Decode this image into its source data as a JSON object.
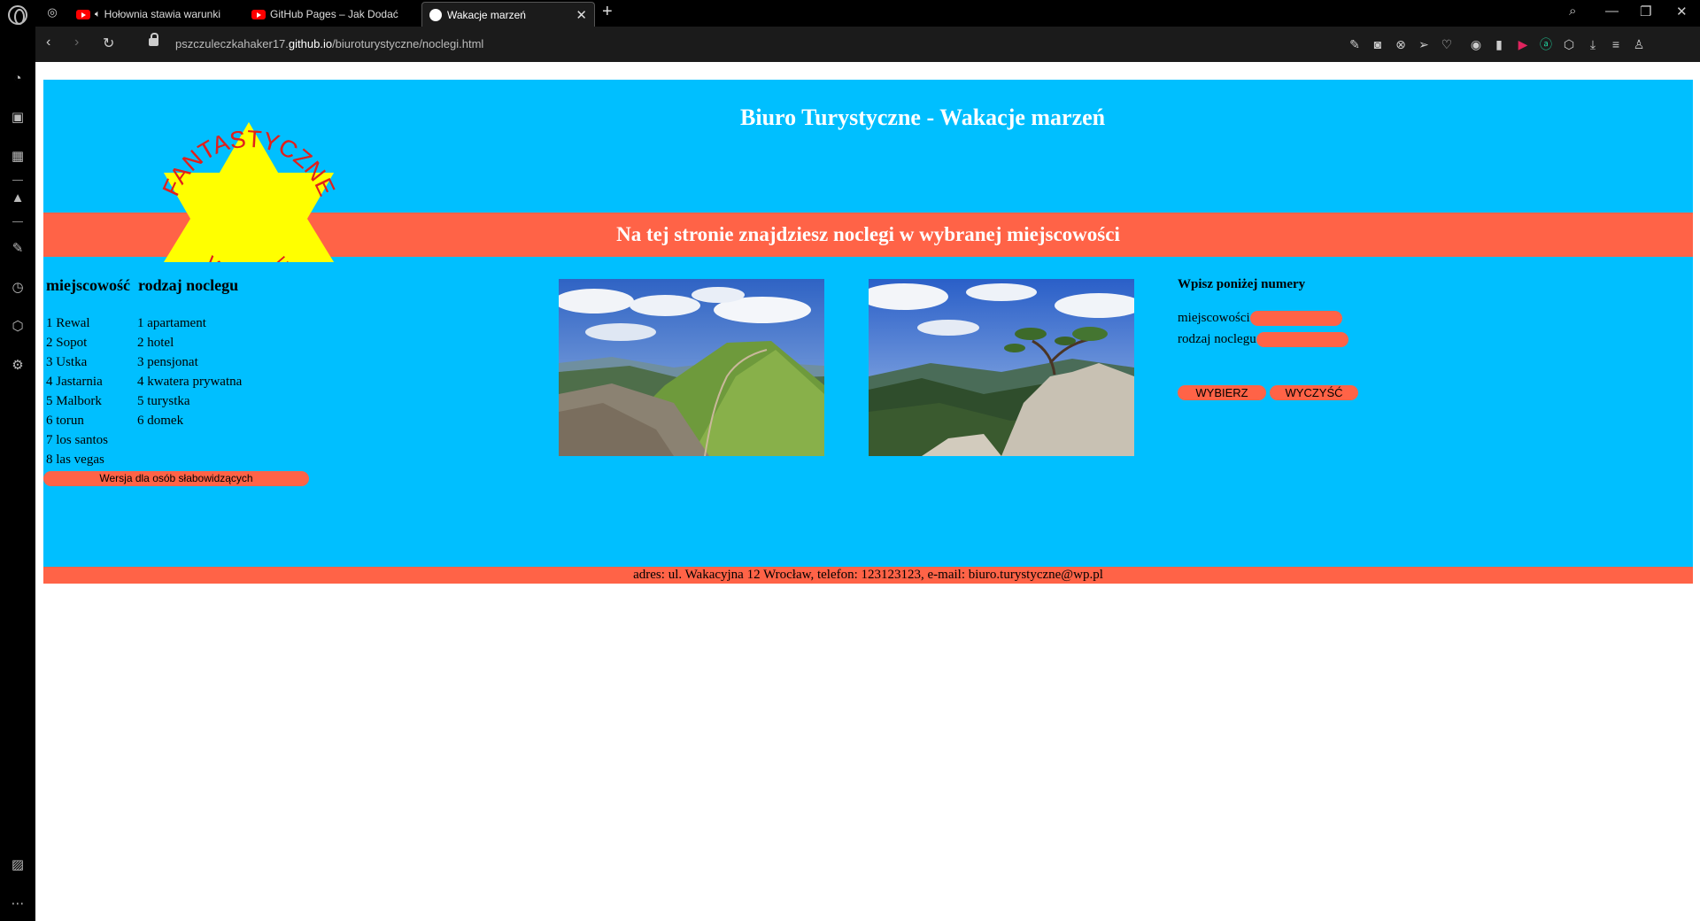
{
  "browser": {
    "tabs": [
      {
        "label": "Hołownia stawia warunki"
      },
      {
        "label": "GitHub Pages – Jak Dodać"
      },
      {
        "label": "Wakacje marzeń"
      }
    ],
    "url_prefix": "pszczuleczkahaker17.",
    "url_domain": "github.io",
    "url_path": "/biuroturystyczne/noclegi.html"
  },
  "site": {
    "title": "Biuro Turystyczne - Wakacje marzeń",
    "logo_text_top": "FANTASTYCZNE",
    "logo_text_bottom": "WAKACJE",
    "banner": "Na tej stronie znajdziesz noclegi w wybranej miejscowości",
    "legend": {
      "heading_place": "miejscowość",
      "heading_type": "rodzaj noclegu",
      "places": [
        "1 Rewal",
        "2 Sopot",
        "3 Ustka",
        "4 Jastarnia",
        "5 Malbork",
        "6 torun",
        "7 los santos",
        "8 las vegas"
      ],
      "types": [
        "1 apartament",
        "2 hotel",
        "3 pensjonat",
        "4 kwatera prywatna",
        "5 turystka",
        "6 domek"
      ]
    },
    "accessibility_button": "Wersja dla osób słabowidzących",
    "form": {
      "title": "Wpisz poniżej numery",
      "place_label": "miejscowości",
      "type_label": "rodzaj noclegu",
      "choose_button": "WYBIERZ",
      "clear_button": "WYCZYŚĆ"
    },
    "footer": "adres: ul. Wakacyjna 12 Wrocław, telefon: 123123123, e-mail: biuro.turystyczne@wp.pl",
    "colors": {
      "page_bg": "#00bfff",
      "accent": "#ff6347"
    }
  }
}
